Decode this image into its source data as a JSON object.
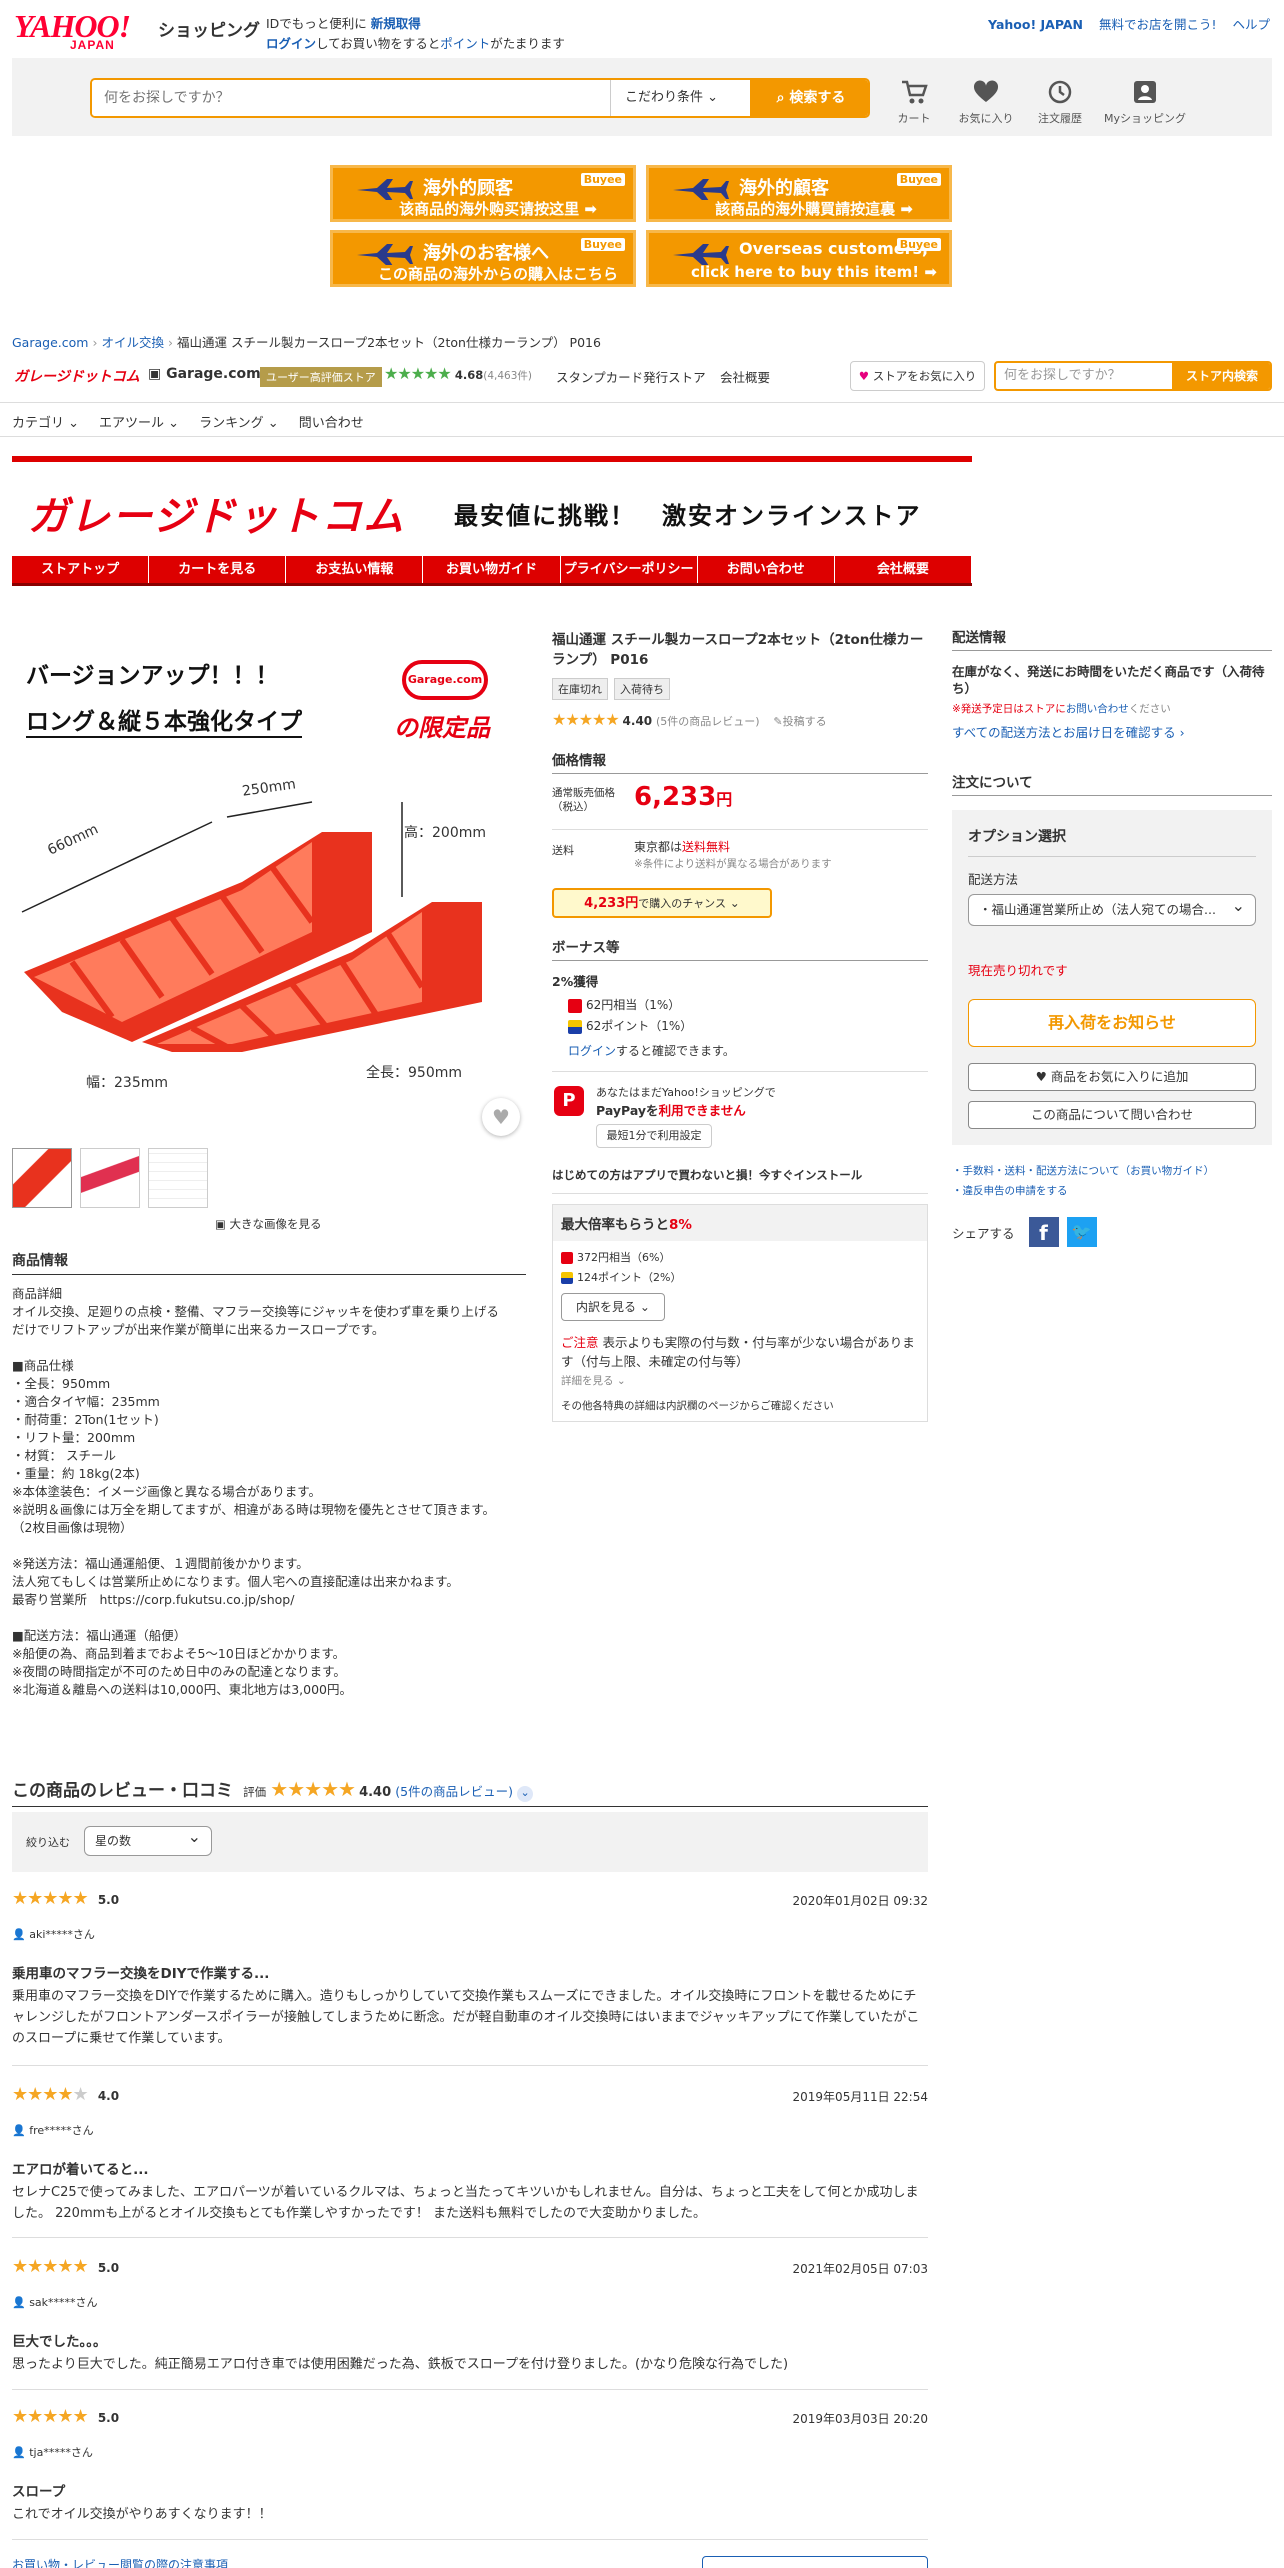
{
  "header": {
    "logo_yahoo": "YAHOO!",
    "logo_japan": "JAPAN",
    "logo_shopping": "ショッピング",
    "msg1_a": "IDでもっと便利に",
    "msg1_link": "新規取得",
    "msg2_link1": "ログイン",
    "msg2_b": "してお買い物をすると",
    "msg2_link2": "ポイント",
    "msg2_c": "がたまります",
    "right_link1": "Yahoo! JAPAN",
    "right_link2": "無料でお店を開こう!",
    "right_link3": "ヘルプ"
  },
  "search": {
    "placeholder": "何をお探しですか？",
    "condition_label": "こだわり条件",
    "button_label": "検索する"
  },
  "header_icons": [
    {
      "label": "カート",
      "icon": "cart-icon"
    },
    {
      "label": "お気に入り",
      "icon": "heart-icon"
    },
    {
      "label": "注文履歴",
      "icon": "history-icon"
    },
    {
      "label": "Myショッピング",
      "icon": "user-icon"
    }
  ],
  "banners": [
    {
      "title": "海外的顾客",
      "sub": "该商品的海外购买请按这里 ➡",
      "brand": "Buyee"
    },
    {
      "title": "海外的顧客",
      "sub": "該商品的海外購買請按這裏 ➡",
      "brand": "Buyee"
    },
    {
      "title": "海外のお客様へ",
      "sub": "この商品の海外からの購入はこちら ➡",
      "brand": "Buyee"
    },
    {
      "title": "Overseas customers,",
      "sub": "click here to buy this item! ➡",
      "brand": "Buyee"
    }
  ],
  "breadcrumb": [
    "Garage.com",
    "オイル交換",
    "福山通運 スチール製カースロープ2本セット（2ton仕様カーランプ） P016"
  ],
  "store": {
    "logo_text": "ガレージドットコム",
    "name": "Garage.com",
    "badge": "ユーザー高評価ストア",
    "rating": "4.68",
    "rating_count": "(4,463件)",
    "stamp": "スタンプカード発行ストア",
    "company": "会社概要",
    "favorite_btn": "ストアをお気に入り",
    "search_placeholder": "何をお探しですか？",
    "search_btn": "ストア内検索"
  },
  "catnav": [
    "カテゴリ ⌄",
    "エアツール ⌄",
    "ランキング ⌄",
    "問い合わせ"
  ],
  "store_banner": {
    "logo": "ガレージドットコム",
    "tagline": "最安値に挑戦！　激安オンラインストア",
    "nav": [
      "ストアトップ",
      "カートを見る",
      "お支払い情報",
      "お買い物ガイド",
      "プライバシーポリシー",
      "お問い合わせ",
      "会社概要"
    ]
  },
  "product_image": {
    "headline1": "バージョンアップ！！！",
    "headline2": "ロング＆縦５本強化タイプ",
    "limited": "の限定品",
    "garage_badge": "Garage.com",
    "dim_250": "250mm",
    "dim_660": "660mm",
    "dim_height": "高：200mm",
    "dim_width": "幅：235mm",
    "dim_length": "全長：950mm",
    "enlarge": "大きな画像を見る"
  },
  "product": {
    "title": "福山通運 スチール製カースロープ2本セット（2ton仕様カーランプ） P016",
    "tags": [
      "在庫切れ",
      "入荷待ち"
    ],
    "rating": "4.40",
    "review_count": "(5件の商品レビュー)",
    "post_review": "投稿する",
    "price_heading": "価格情報",
    "price_label": "通常販売価格（税込）",
    "price_value": "6,233",
    "price_yen": "円",
    "shipping_label": "送料",
    "shipping_area": "東京都は",
    "shipping_free": "送料無料",
    "shipping_note": "※条件により送料が異なる場合があります",
    "chance_price": "4,233円",
    "chance_text": "で購入のチャンス",
    "bonus_heading": "ボーナス等",
    "bonus_rate": "2%獲得",
    "bonus1": "62円相当（1%）",
    "bonus2": "62ポイント（1%）",
    "login_link": "ログイン",
    "login_text": "すると確認できます。",
    "paypay_msg1": "あなたはまだYahoo!ショッピングで",
    "paypay_msg2a": "PayPayを",
    "paypay_msg2b": "利用できません",
    "paypay_btn": "最短1分で利用設定",
    "app_promo": "はじめての方はアプリで買わないと損！今すぐインストール",
    "max_heading_a": "最大倍率もらうと",
    "max_heading_b": "8%",
    "max1": "372円相当（6%）",
    "max2": "124ポイント（2%）",
    "breakdown_btn": "内訳を見る",
    "caution_red": "ご注意",
    "caution_text": "表示よりも実際の付与数・付与率が少ない場合があります（付与上限、未確定の付与等）",
    "details_link": "詳細を見る",
    "other_note": "その他各特典の詳細は内訳欄のページからご確認ください"
  },
  "description": {
    "heading": "商品情報",
    "body": "商品詳細\nオイル交換、足廻りの点検・整備、マフラー交換等にジャッキを使わず車を乗り上げる\nだけでリフトアップが出来作業が簡単に出来るカースロープです。\n\n■商品仕様\n・全長：950mm\n・適合タイヤ幅：235mm\n・耐荷重：2Ton(1セット)\n・リフト量：200mm\n・材質： スチール\n・重量：約 18kg(2本)\n※本体塗装色：イメージ画像と異なる場合があります。\n※説明＆画像には万全を期してますが、相違がある時は現物を優先とさせて頂きます。\n（2枚目画像は現物）\n\n※発送方法：福山通運船便、１週間前後かかります。\n法人宛てもしくは営業所止めになります。個人宅への直接配達は出来かねます。\n最寄り営業所　https://corp.fukutsu.co.jp/shop/\n\n■配送方法：福山通運（船便）\n※船便の為、商品到着までおよそ5〜10日ほどかかります。\n※夜間の時間指定が不可のため日中のみの配達となります。\n※北海道＆離島への送料は10,000円、東北地方は3,000円。"
  },
  "delivery": {
    "heading": "配送情報",
    "msg": "在庫がなく、発送にお時間をいただく商品です（入荷待ち）",
    "note_a": "※発送予定日はストアに",
    "note_link": "お問い合わせ",
    "note_b": "ください",
    "link": "すべての配送方法とお届け日を確認する ›"
  },
  "order": {
    "heading": "注文について",
    "option_heading": "オプション選択",
    "method_label": "配送方法",
    "method_value": "・福山通運営業所止め（法人宛ての場合...",
    "out_of_stock": "現在売り切れです",
    "restock_btn": "再入荷をお知らせ",
    "fav_btn": "商品をお気に入りに追加",
    "inquiry_btn": "この商品について問い合わせ",
    "link1": "手数料・送料・配送方法について（お買い物ガイド）",
    "link2": "違反申告の申請をする",
    "share_label": "シェアする"
  },
  "reviews": {
    "heading": "この商品のレビュー・口コミ",
    "eval_label": "評価",
    "rating": "4.40",
    "count_link": "(5件の商品レビュー)",
    "filter_label": "絞り込む",
    "filter_value": "星の数",
    "items": [
      {
        "stars": 5,
        "score": "5.0",
        "date": "2020年01月02日 09:32",
        "user": "aki*****さん",
        "title": "乗用車のマフラー交換をDIYで作業する...",
        "body": "乗用車のマフラー交換をDIYで作業するために購入。造りもしっかりしていて交換作業もスムーズにできました。オイル交換時にフロントを載せるためにチャレンジしたがフロントアンダースポイラーが接触してしまうために断念。だが軽自動車のオイル交換時にはいままでジャッキアップにて作業していたがこのスロープに乗せて作業しています。"
      },
      {
        "stars": 4,
        "score": "4.0",
        "date": "2019年05月11日 22:54",
        "user": "fre*****さん",
        "title": "エアロが着いてると...",
        "body": "セレナC25で使ってみました、エアロパーツが着いているクルマは、ちょっと当たってキツいかもしれません。自分は、ちょっと工夫をして何とか成功しました。 220mmも上がるとオイル交換もとても作業しやすかったです！ また送料も無料でしたので大変助かりました。"
      },
      {
        "stars": 5,
        "score": "5.0",
        "date": "2021年02月05日 07:03",
        "user": "sak*****さん",
        "title": "巨大でした。。。",
        "body": "思ったより巨大でした。純正簡易エアロ付き車では使用困難だった為、鉄板でスロープを付け登りました。(かなり危険な行為でした)"
      },
      {
        "stars": 5,
        "score": "5.0",
        "date": "2019年03月03日 20:20",
        "user": "tja*****さん",
        "title": "スロープ",
        "body": "これでオイル交換がやりあすくなります！！"
      }
    ],
    "footer_link": "お買い物・レビュー閲覧の際の注意事項"
  },
  "colors": {
    "accent": "#f39800",
    "red": "#e60012",
    "link": "#1a5fb4"
  }
}
